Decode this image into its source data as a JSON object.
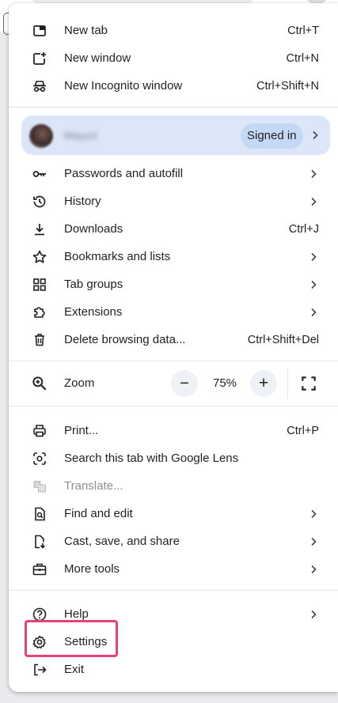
{
  "section1": [
    {
      "label": "New tab",
      "shortcut": "Ctrl+T",
      "icon": "new-tab-icon"
    },
    {
      "label": "New window",
      "shortcut": "Ctrl+N",
      "icon": "new-window-icon"
    },
    {
      "label": "New Incognito window",
      "shortcut": "Ctrl+Shift+N",
      "icon": "incognito-icon"
    }
  ],
  "profile": {
    "name": "Mayuri",
    "status": "Signed in"
  },
  "section2": [
    {
      "label": "Passwords and autofill",
      "icon": "key-icon",
      "submenu": true
    },
    {
      "label": "History",
      "icon": "history-icon",
      "submenu": true
    },
    {
      "label": "Downloads",
      "shortcut": "Ctrl+J",
      "icon": "download-icon"
    },
    {
      "label": "Bookmarks and lists",
      "icon": "star-icon",
      "submenu": true
    },
    {
      "label": "Tab groups",
      "icon": "tab-groups-icon",
      "submenu": true
    },
    {
      "label": "Extensions",
      "icon": "puzzle-icon",
      "submenu": true
    },
    {
      "label": "Delete browsing data...",
      "shortcut": "Ctrl+Shift+Del",
      "icon": "trash-icon"
    }
  ],
  "zoom": {
    "label": "Zoom",
    "value": "75%",
    "minus": "−",
    "plus": "+"
  },
  "section3": [
    {
      "label": "Print...",
      "shortcut": "Ctrl+P",
      "icon": "print-icon"
    },
    {
      "label": "Search this tab with Google Lens",
      "icon": "lens-icon"
    },
    {
      "label": "Translate...",
      "icon": "translate-icon",
      "disabled": true
    },
    {
      "label": "Find and edit",
      "icon": "find-icon",
      "submenu": true
    },
    {
      "label": "Cast, save, and share",
      "icon": "cast-save-icon",
      "submenu": true
    },
    {
      "label": "More tools",
      "icon": "toolbox-icon",
      "submenu": true
    }
  ],
  "section4": [
    {
      "label": "Help",
      "icon": "help-icon",
      "submenu": true
    },
    {
      "label": "Settings",
      "icon": "gear-icon"
    },
    {
      "label": "Exit",
      "icon": "exit-icon"
    }
  ],
  "colors": {
    "highlight": "#e8417a",
    "profile_bg": "#dbe6f8",
    "signed_in_bg": "#c5d8f6"
  }
}
